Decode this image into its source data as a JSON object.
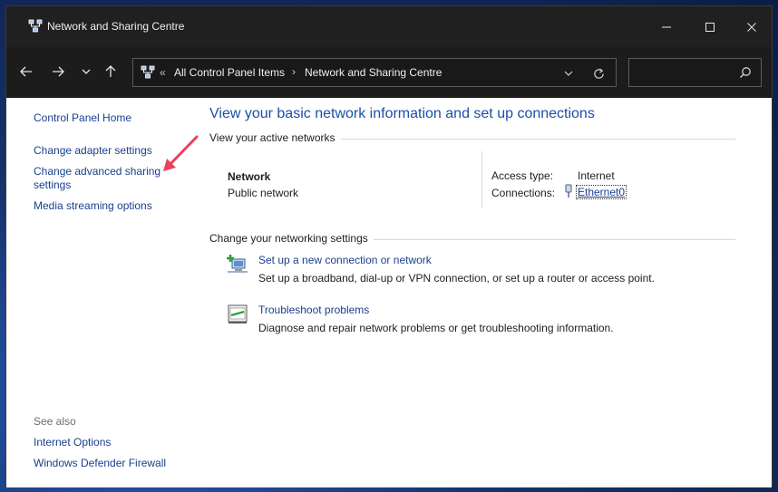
{
  "window": {
    "title": "Network and Sharing Centre"
  },
  "address_bar": {
    "separator": "«",
    "crumbs": [
      "All Control Panel Items",
      "Network and Sharing Centre"
    ],
    "arrow": "›"
  },
  "search": {
    "placeholder": ""
  },
  "sidebar": {
    "home": "Control Panel Home",
    "links": [
      "Change adapter settings",
      "Change advanced sharing settings",
      "Media streaming options"
    ],
    "see_also_label": "See also",
    "see_also": [
      "Internet Options",
      "Windows Defender Firewall"
    ]
  },
  "main": {
    "title": "View your basic network information and set up connections",
    "active_networks_heading": "View your active networks",
    "network": {
      "name": "Network",
      "category": "Public network",
      "access_type_label": "Access type:",
      "access_type_value": "Internet",
      "connections_label": "Connections:",
      "connection_name": "Ethernet0"
    },
    "settings_heading": "Change your networking settings",
    "tasks": [
      {
        "link": "Set up a new connection or network",
        "description": "Set up a broadband, dial-up or VPN connection, or set up a router or access point.",
        "icon": "network-setup-icon"
      },
      {
        "link": "Troubleshoot problems",
        "description": "Diagnose and repair network problems or get troubleshooting information.",
        "icon": "troubleshoot-icon"
      }
    ]
  },
  "colors": {
    "link": "#1a3f8e",
    "title": "#1c4ea7",
    "titlebar": "#202020",
    "annotation_arrow": "#e8415b"
  }
}
